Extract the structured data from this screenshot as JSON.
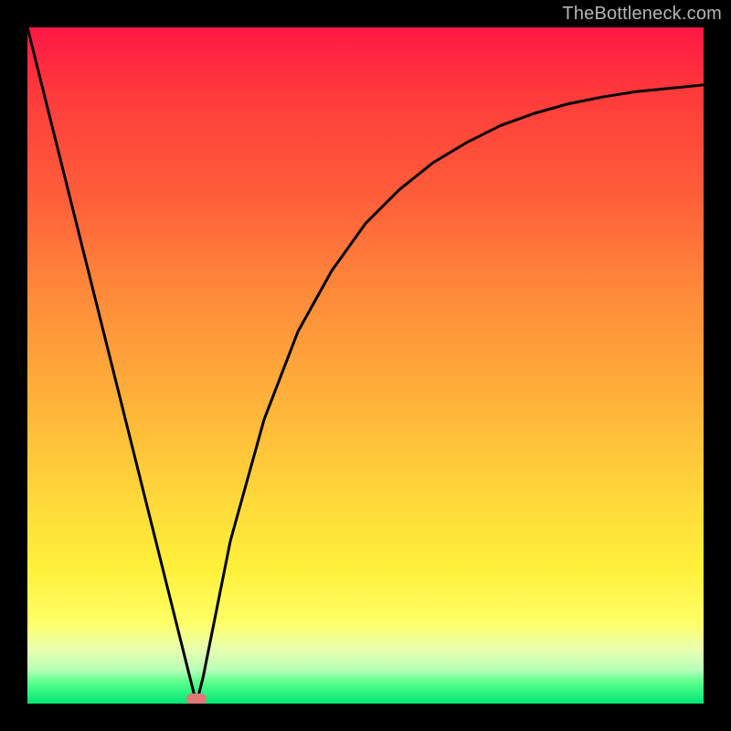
{
  "watermark": "TheBottleneck.com",
  "chart_data": {
    "type": "line",
    "title": "",
    "xlabel": "",
    "ylabel": "",
    "xlim": [
      0,
      100
    ],
    "ylim": [
      0,
      100
    ],
    "series": [
      {
        "name": "bottleneck-curve",
        "x": [
          0,
          5,
          10,
          15,
          20,
          22,
          24,
          25,
          26,
          28,
          30,
          35,
          40,
          45,
          50,
          55,
          60,
          65,
          70,
          75,
          80,
          85,
          90,
          95,
          100
        ],
        "y": [
          100,
          80,
          60,
          40,
          20,
          12,
          4,
          0,
          4,
          14,
          24,
          42,
          55,
          64,
          71,
          76,
          80,
          83,
          85.5,
          87.3,
          88.7,
          89.7,
          90.5,
          91,
          91.5
        ]
      }
    ],
    "optimum_marker": {
      "x": 25,
      "y": 0
    },
    "background_gradient": {
      "top_color": "#ff1744",
      "bottom_color": "#00e676",
      "meaning": "top=high bottleneck, bottom=no bottleneck"
    }
  }
}
